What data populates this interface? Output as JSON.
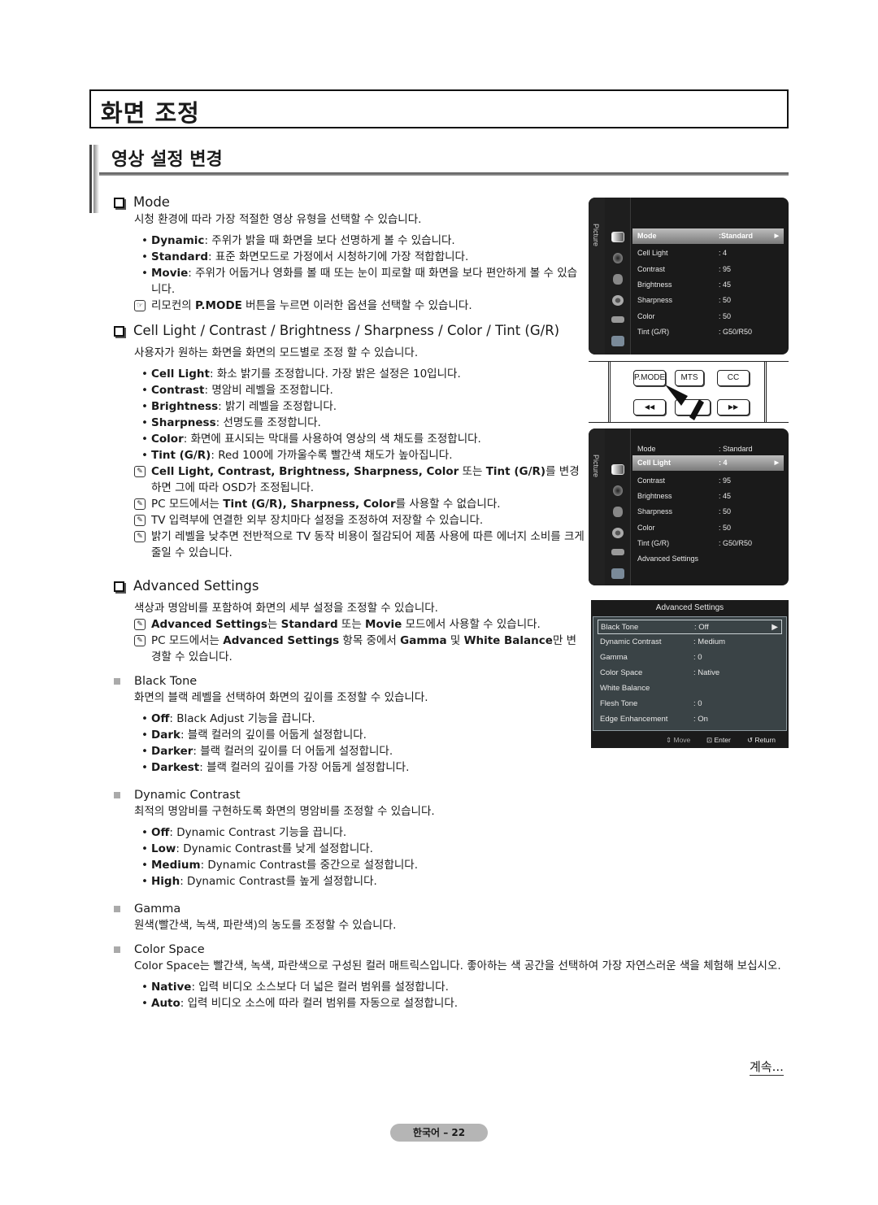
{
  "page_title": "화면 조정",
  "section_title": "영상 설정 변경",
  "mode": {
    "heading": "Mode",
    "intro": "시청 환경에 따라 가장 적절한 영상 유형을 선택할 수 있습니다.",
    "bullets": [
      {
        "term": "Dynamic",
        "text": ": 주위가 밝을 때 화면을 보다 선명하게 볼 수 있습니다."
      },
      {
        "term": "Standard",
        "text": ": 표준 화면모드로 가정에서 시청하기에 가장 적합합니다."
      },
      {
        "term": "Movie",
        "text": ": 주위가 어둡거나 영화를 볼 때 또는 눈이 피로할 때 화면을 보다 편안하게 볼 수 있습니다."
      }
    ],
    "remote_note": {
      "pre": "리모컨의 ",
      "term": "P.MODE",
      "post": " 버튼을 누르면 이러한 옵션을 선택할 수 있습니다."
    }
  },
  "picture": {
    "heading": "Cell Light / Contrast / Brightness / Sharpness / Color / Tint (G/R)",
    "intro": "사용자가 원하는 화면을 화면의 모드별로 조정 할 수 있습니다.",
    "bullets": [
      {
        "term": "Cell Light",
        "text": ": 화소 밝기를 조정합니다. 가장 밝은 설정은 10입니다."
      },
      {
        "term": "Contrast",
        "text": ": 명암비 레벨을 조정합니다."
      },
      {
        "term": "Brightness",
        "text": ": 밝기 레벨을 조정합니다."
      },
      {
        "term": "Sharpness",
        "text": ": 선명도를 조정합니다."
      },
      {
        "term": "Color",
        "text": ": 화면에 표시되는 막대를 사용하여 영상의 색 채도를 조정합니다."
      },
      {
        "term": "Tint (G/R)",
        "text": ": Red 100에 가까울수록 빨간색 채도가 높아집니다."
      }
    ],
    "notes": [
      {
        "term": "Cell Light, Contrast, Brightness, Sharpness, Color",
        "mid": " 또는 ",
        "term2": "Tint (G/R)",
        "post": "를 변경하면 그에 따라 OSD가 조정됩니다."
      },
      {
        "pre": "PC 모드에서는 ",
        "term": "Tint (G/R), Sharpness, Color",
        "post": "를 사용할 수 없습니다."
      },
      {
        "text": "TV 입력부에 연결한 외부 장치마다 설정을 조정하여 저장할 수 있습니다."
      },
      {
        "text": "밝기 레벨을 낮추면 전반적으로 TV 동작 비용이 절감되어 제품 사용에 따른 에너지 소비를 크게 줄일 수 있습니다."
      }
    ]
  },
  "advanced": {
    "heading": "Advanced Settings",
    "intro": "색상과 명암비를 포함하여 화면의 세부 설정을 조정할 수 있습니다.",
    "notes": [
      {
        "term": "Advanced Settings",
        "mid": "는 ",
        "term2": "Standard",
        "mid2": " 또는 ",
        "term3": "Movie",
        "post": " 모드에서 사용할 수 있습니다."
      },
      {
        "pre": "PC 모드에서는 ",
        "term": "Advanced Settings",
        "mid": " 항목 중에서 ",
        "term2": "Gamma",
        "mid2": " 및 ",
        "term3": "White Balance",
        "post": "만 변경할 수 있습니다."
      }
    ],
    "black_tone": {
      "heading": "Black Tone",
      "intro": "화면의 블랙 레벨을 선택하여 화면의 깊이를 조정할 수 있습니다.",
      "bullets": [
        {
          "term": "Off",
          "text": ": Black Adjust 기능을 끕니다."
        },
        {
          "term": "Dark",
          "text": ": 블랙 컬러의 깊이를 어둡게 설정합니다."
        },
        {
          "term": "Darker",
          "text": ": 블랙 컬러의 깊이를 더 어둡게 설정합니다."
        },
        {
          "term": "Darkest",
          "text": ": 블랙 컬러의 깊이를 가장 어둡게 설정합니다."
        }
      ]
    },
    "dynamic_contrast": {
      "heading": "Dynamic Contrast",
      "intro": "최적의 명암비를 구현하도록 화면의 명암비를 조정할 수 있습니다.",
      "bullets": [
        {
          "term": "Off",
          "text": ": Dynamic Contrast 기능을 끕니다."
        },
        {
          "term": "Low",
          "text": ": Dynamic Contrast를 낮게 설정합니다."
        },
        {
          "term": "Medium",
          "text": ": Dynamic Contrast를 중간으로 설정합니다."
        },
        {
          "term": "High",
          "text": ": Dynamic Contrast를 높게 설정합니다."
        }
      ]
    },
    "gamma": {
      "heading": "Gamma",
      "intro": "원색(빨간색, 녹색, 파란색)의 농도를 조정할 수 있습니다."
    },
    "color_space": {
      "heading": "Color Space",
      "intro": "Color Space는 빨간색, 녹색, 파란색으로 구성된 컬러 매트릭스입니다. 좋아하는 색 공간을 선택하여 가장 자연스러운 색을 체험해 보십시오.",
      "bullets": [
        {
          "term": "Native",
          "text": ": 입력 비디오 소스보다 더 넓은 컬러 범위를 설정합니다."
        },
        {
          "term": "Auto",
          "text": ": 입력 비디오 소스에 따라 컬러 범위를 자동으로 설정합니다."
        }
      ]
    }
  },
  "osd1": {
    "side_label": "Picture",
    "rows": [
      {
        "k": "Mode",
        "v": ":Standard",
        "selected": true
      },
      {
        "k": "Cell Light",
        "v": ": 4"
      },
      {
        "k": "Contrast",
        "v": ": 95"
      },
      {
        "k": "Brightness",
        "v": ": 45"
      },
      {
        "k": "Sharpness",
        "v": ": 50"
      },
      {
        "k": "Color",
        "v": ": 50"
      },
      {
        "k": "Tint (G/R)",
        "v": ": G50/R50"
      }
    ]
  },
  "remote": {
    "buttons": [
      "P.MODE",
      "MTS",
      "CC"
    ],
    "rewind_icon": "◀◀",
    "ffwd_icon": "▶▶"
  },
  "osd2": {
    "side_label": "Picture",
    "rows": [
      {
        "k": "Mode",
        "v": ": Standard"
      },
      {
        "k": "Cell Light",
        "v": ": 4",
        "selected": true
      },
      {
        "k": "Contrast",
        "v": ": 95"
      },
      {
        "k": "Brightness",
        "v": ": 45"
      },
      {
        "k": "Sharpness",
        "v": ": 50"
      },
      {
        "k": "Color",
        "v": ": 50"
      },
      {
        "k": "Tint (G/R)",
        "v": ": G50/R50"
      },
      {
        "k": "Advanced Settings",
        "v": ""
      }
    ]
  },
  "adv_osd": {
    "title": "Advanced Settings",
    "rows": [
      {
        "k": "Black Tone",
        "v": ": Off",
        "selected": true
      },
      {
        "k": "Dynamic Contrast",
        "v": ": Medium"
      },
      {
        "k": "Gamma",
        "v": ": 0"
      },
      {
        "k": "Color Space",
        "v": ": Native"
      },
      {
        "k": "White Balance",
        "v": ""
      },
      {
        "k": "Flesh Tone",
        "v": ": 0"
      },
      {
        "k": "Edge Enhancement",
        "v": ": On"
      }
    ],
    "footer": {
      "move": "Move",
      "enter": "Enter",
      "return": "Return"
    }
  },
  "continued": "계속...",
  "page_number": "한국어 – 22"
}
